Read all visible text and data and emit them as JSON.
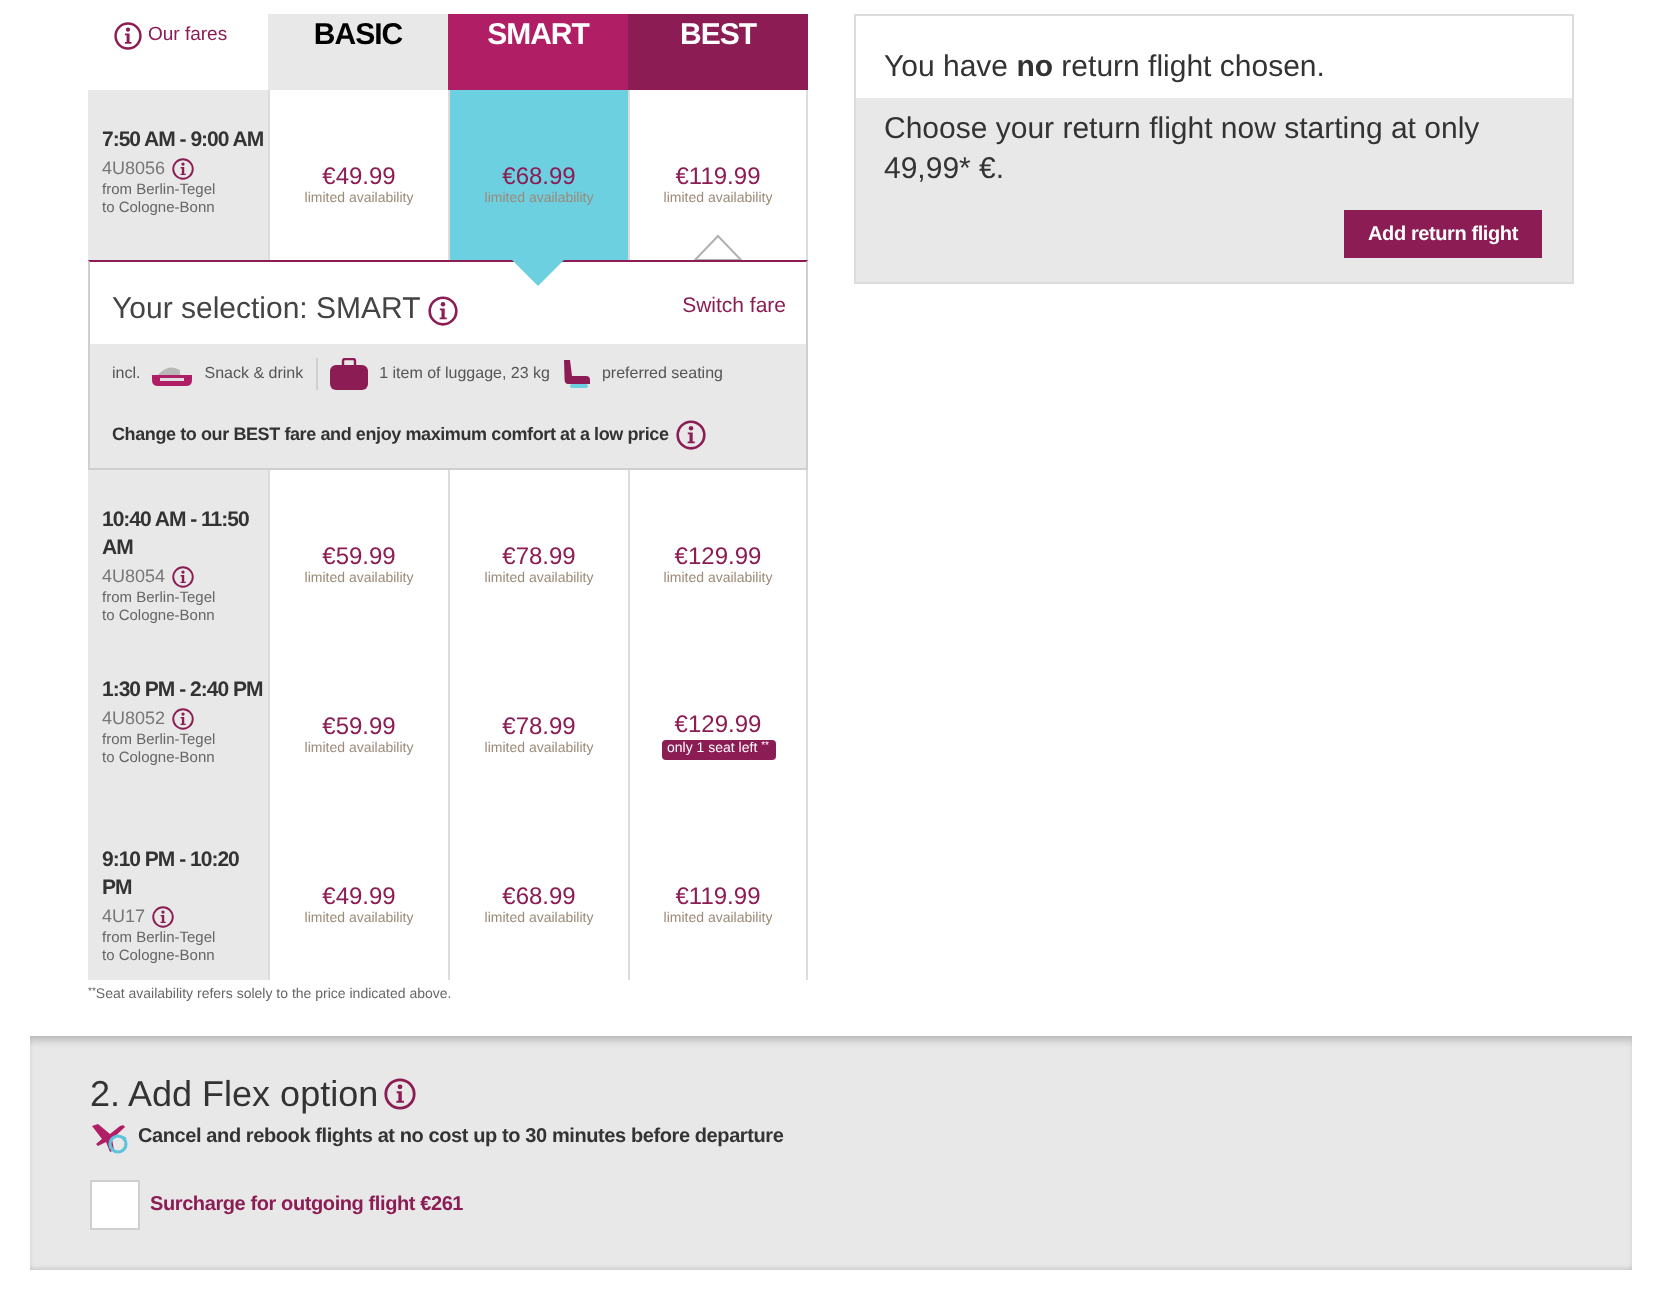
{
  "fares_table": {
    "info_link": "Our fares",
    "fares": [
      {
        "name": "BASIC",
        "color": "#e8e8e8",
        "suggested": false
      },
      {
        "name": "SMART",
        "color": "#b01e65",
        "suggested": false
      },
      {
        "name": "BEST",
        "color": "#8b1c54",
        "suggested": true
      }
    ],
    "flights": [
      {
        "time": "7:50 AM - 9:00 AM",
        "flight_number": "4U8056",
        "route_from": "from Berlin-Tegel",
        "route_to": "to Cologne-Bonn",
        "prices": [
          {
            "price": "€49.99",
            "kind": "note",
            "availability": "limited availability",
            "selected": false
          },
          {
            "price": "€68.99",
            "kind": "note",
            "availability": "limited availability",
            "selected": true
          },
          {
            "price": "€119.99",
            "kind": "note",
            "availability": "limited availability",
            "selected": false
          }
        ]
      },
      {
        "time": "10:40 AM - 11:50 AM",
        "flight_number": "4U8054",
        "route_from": "from Berlin-Tegel",
        "route_to": "to Cologne-Bonn",
        "prices": [
          {
            "price": "€59.99",
            "kind": "note",
            "availability": "limited availability",
            "selected": false
          },
          {
            "price": "€78.99",
            "kind": "note",
            "availability": "limited availability",
            "selected": false
          },
          {
            "price": "€129.99",
            "kind": "note",
            "availability": "limited availability",
            "selected": false
          }
        ]
      },
      {
        "time": "1:30 PM - 2:40 PM",
        "flight_number": "4U8052",
        "route_from": "from Berlin-Tegel",
        "route_to": "to Cologne-Bonn",
        "prices": [
          {
            "price": "€59.99",
            "kind": "note",
            "availability": "limited availability",
            "selected": false
          },
          {
            "price": "€78.99",
            "kind": "note",
            "availability": "limited availability",
            "selected": false
          },
          {
            "price": "€129.99",
            "kind": "badge",
            "availability": "only 1 seat left",
            "availability_mark": "**",
            "selected": false
          }
        ]
      },
      {
        "time": "9:10 PM - 10:20 PM",
        "flight_number": "4U17",
        "route_from": "from Berlin-Tegel",
        "route_to": "to Cologne-Bonn",
        "prices": [
          {
            "price": "€49.99",
            "kind": "note",
            "availability": "limited availability",
            "selected": false
          },
          {
            "price": "€68.99",
            "kind": "note",
            "availability": "limited availability",
            "selected": false
          },
          {
            "price": "€119.99",
            "kind": "note",
            "availability": "limited availability",
            "selected": false
          }
        ]
      }
    ],
    "selection": {
      "title": "Your selection: SMART",
      "switch_link": "Switch fare",
      "inclusions_prefix": "incl.",
      "inclusions": [
        {
          "kind": "snack",
          "label": "Snack & drink"
        },
        {
          "kind": "luggage",
          "label": "1 item of luggage, 23 kg"
        },
        {
          "kind": "seat",
          "label": "preferred seating"
        }
      ],
      "upsell": "Change to our BEST fare and enjoy maximum comfort at a low price"
    },
    "footnote_mark": "**",
    "footnote": "Seat availability refers solely to the price indicated above."
  },
  "return_flight": {
    "status": "You have **no** return flight chosen.",
    "offer": "Choose your return flight now starting at only 49,99* €.",
    "button": "Add return flight"
  },
  "flex_option": {
    "title": "2. Add Flex option",
    "description": "Cancel and rebook flights at no cost up to 30 minutes before departure",
    "checkbox": {
      "label": "Surcharge for outgoing flight €261",
      "checked": false
    }
  }
}
